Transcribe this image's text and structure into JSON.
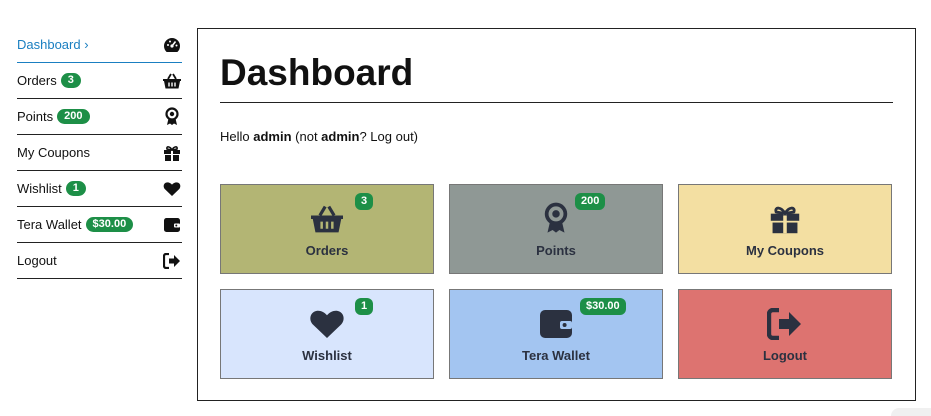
{
  "sidebar": {
    "items": [
      {
        "label": "Dashboard ›",
        "icon": "gauge-icon"
      },
      {
        "label": "Orders",
        "badge": "3",
        "icon": "basket-icon"
      },
      {
        "label": "Points",
        "badge": "200",
        "icon": "award-icon"
      },
      {
        "label": "My Coupons",
        "icon": "gift-icon"
      },
      {
        "label": "Wishlist",
        "badge": "1",
        "icon": "heart-icon"
      },
      {
        "label": "Tera Wallet",
        "badge": "$30.00",
        "icon": "wallet-icon"
      },
      {
        "label": "Logout",
        "icon": "logout-icon"
      }
    ]
  },
  "main": {
    "title": "Dashboard",
    "hello": {
      "prefix": "Hello ",
      "user": "admin",
      "middle": " (not ",
      "user2": "admin",
      "suffix": "? Log out)"
    },
    "tiles": [
      {
        "label": "Orders",
        "badge": "3",
        "icon": "basket-icon",
        "bg": "#b3b574"
      },
      {
        "label": "Points",
        "badge": "200",
        "icon": "award-icon",
        "bg": "#8f9895"
      },
      {
        "label": "My Coupons",
        "icon": "gift-icon",
        "bg": "#f3dfa2"
      },
      {
        "label": "Wishlist",
        "badge": "1",
        "icon": "heart-icon",
        "bg": "#d8e5fd"
      },
      {
        "label": "Tera Wallet",
        "badge": "$30.00",
        "icon": "wallet-icon",
        "bg": "#a3c5f1"
      },
      {
        "label": "Logout",
        "icon": "logout-icon",
        "bg": "#dd7370"
      }
    ]
  },
  "colors": {
    "active_link": "#1a7fc1",
    "badge": "#1d8f47",
    "icon_dark": "#2b3140"
  }
}
